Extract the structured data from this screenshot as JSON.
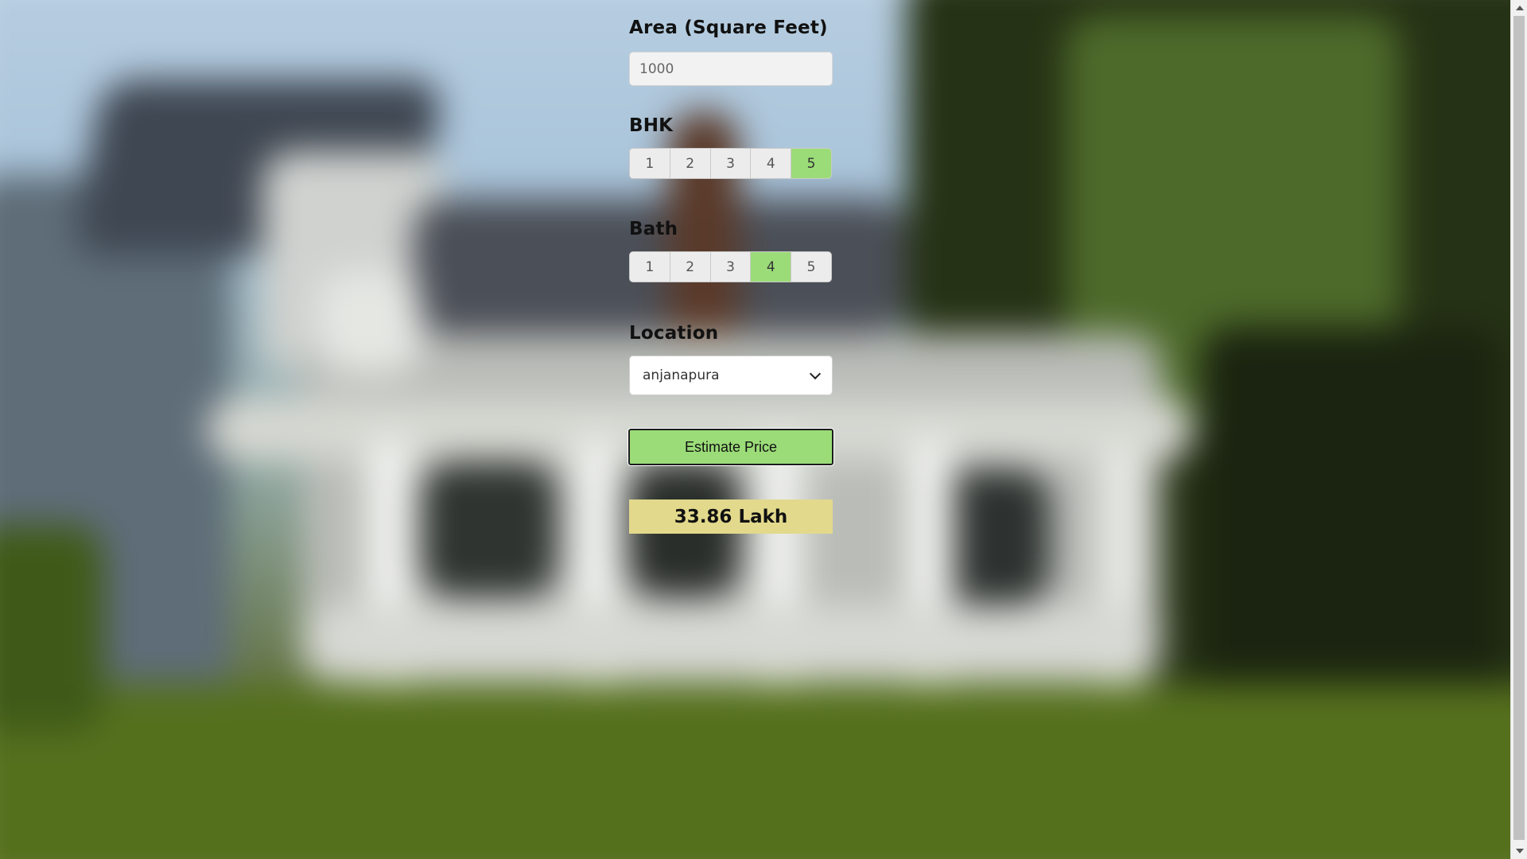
{
  "form": {
    "area": {
      "label": "Area (Square Feet)",
      "value": "1000"
    },
    "bhk": {
      "label": "BHK",
      "options": [
        "1",
        "2",
        "3",
        "4",
        "5"
      ],
      "selected": "5"
    },
    "bath": {
      "label": "Bath",
      "options": [
        "1",
        "2",
        "3",
        "4",
        "5"
      ],
      "selected": "4"
    },
    "location": {
      "label": "Location",
      "selected": "anjanapura"
    },
    "estimate_button": "Estimate Price",
    "result": "33.86 Lakh"
  },
  "colors": {
    "selected_option": "#9bdc78",
    "button": "#9bdc78",
    "result_background": "#e2d98c"
  },
  "icons": {
    "select_chevron": "chevron-down-icon",
    "scroll_up": "scroll-up-arrow-icon",
    "scroll_down": "scroll-down-arrow-icon"
  }
}
